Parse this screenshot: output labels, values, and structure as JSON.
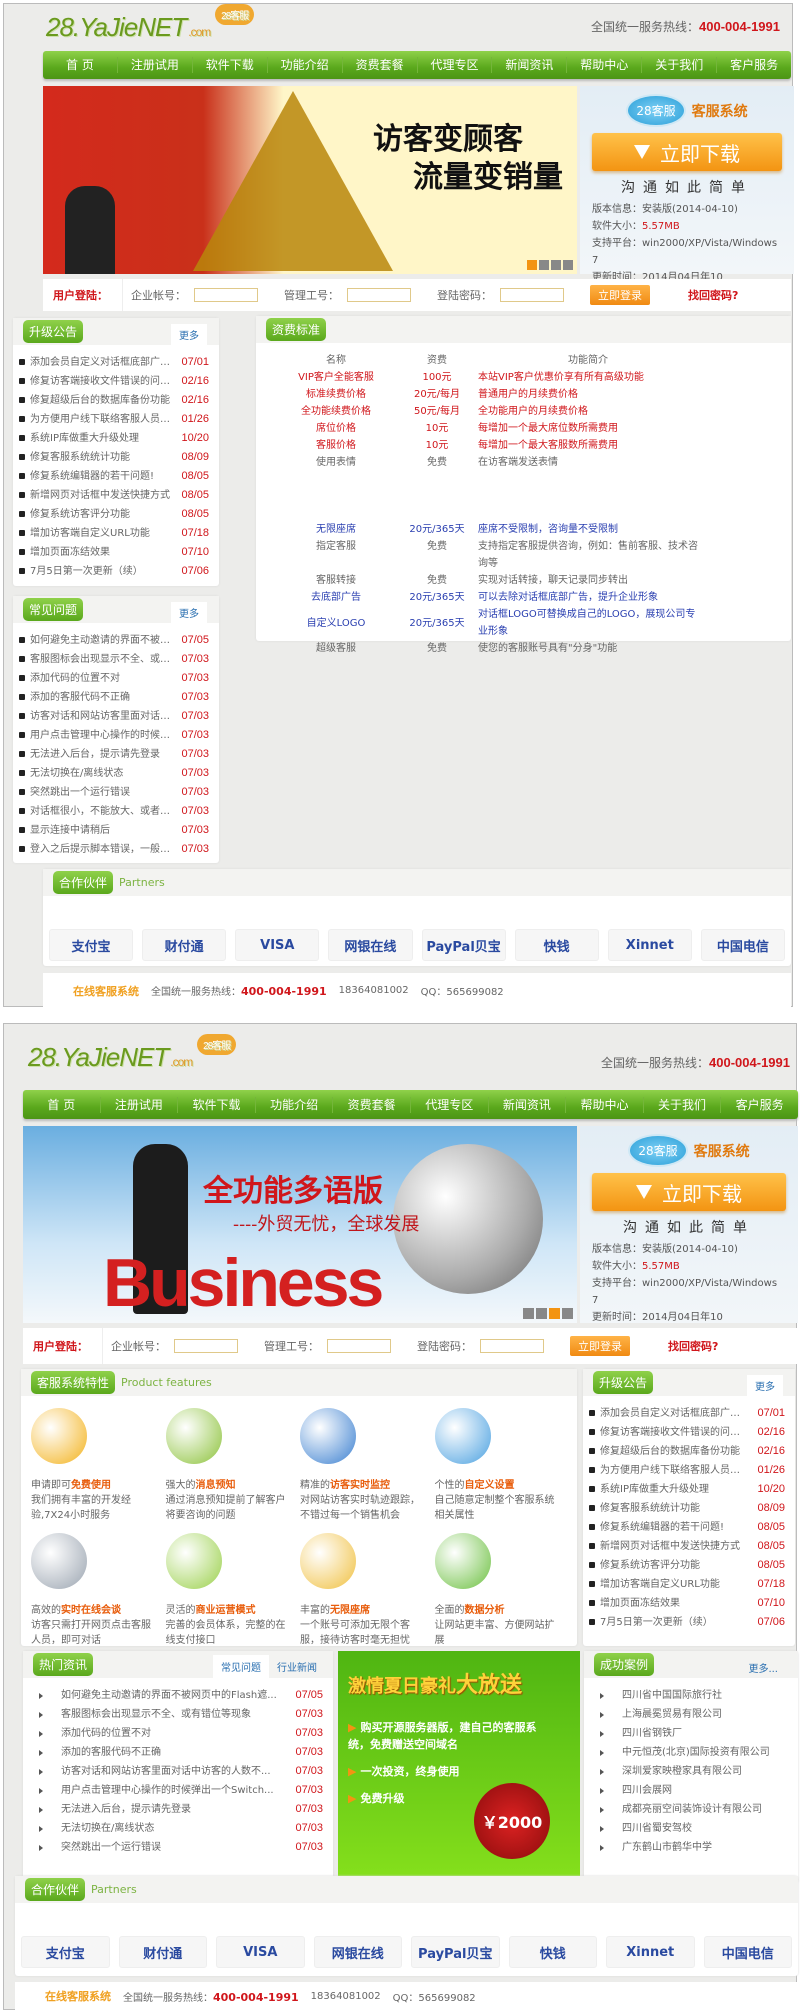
{
  "brand": {
    "logo": "28.YaJieNET",
    "logo_suffix": ".com",
    "logo_badge": "28客服"
  },
  "hotline_label": "全国统一服务热线：",
  "hotline": "400-004-1991",
  "nav": [
    "首 页",
    "注册试用",
    "软件下载",
    "功能介绍",
    "资费套餐",
    "代理专区",
    "新闻资讯",
    "帮助中心",
    "关于我们",
    "客户服务"
  ],
  "banners": {
    "first": {
      "line1": "访客变顾客",
      "line2": "流量变销量"
    },
    "second": {
      "line1": "全功能多语版",
      "line2": "----外贸无忧，全球发展",
      "word": "Business"
    }
  },
  "download": {
    "badge": "28客服",
    "title": "客服系统",
    "button": "立即下载",
    "slogan": "沟通如此简单",
    "rows": [
      {
        "label": "版本信息：",
        "value": "安装版(2014-04-10)"
      },
      {
        "label": "软件大小：",
        "value": "5.57MB"
      },
      {
        "label": "支持平台：",
        "value": "win2000/XP/Vista/Windows 7"
      },
      {
        "label": "更新时间：",
        "value": "2014月04日年10"
      }
    ]
  },
  "login": {
    "title": "用户登陆：",
    "company": "企业帐号：",
    "staff": "管理工号：",
    "password": "登陆密码：",
    "submit": "立即登录",
    "forgot": "找回密码?"
  },
  "upgrade": {
    "title": "升级公告",
    "more": "更多",
    "items": [
      {
        "t": "添加会员自定义对话框底部广告...",
        "d": "07/01"
      },
      {
        "t": "修复访客端接收文件错误的问题...",
        "d": "02/16"
      },
      {
        "t": "修复超级后台的数据库备份功能",
        "d": "02/16"
      },
      {
        "t": "为方便用户线下联络客服人员，...",
        "d": "01/26"
      },
      {
        "t": "系统IP库做重大升级处理",
        "d": "10/20"
      },
      {
        "t": "修复客服系统统计功能",
        "d": "08/09"
      },
      {
        "t": "修复系统编辑器的若干问题!",
        "d": "08/05"
      },
      {
        "t": "新增网页对话框中发送快捷方式",
        "d": "08/05"
      },
      {
        "t": "修复系统访客评分功能",
        "d": "08/05"
      },
      {
        "t": "增加访客端自定义URL功能",
        "d": "07/18"
      },
      {
        "t": "增加页面冻结效果",
        "d": "07/10"
      },
      {
        "t": "7月5日第一次更新（续）",
        "d": "07/06"
      }
    ]
  },
  "faq": {
    "title": "常见问题",
    "more": "更多",
    "items": [
      {
        "t": "如何避免主动邀请的界面不被网...",
        "d": "07/05"
      },
      {
        "t": "客服图标会出现显示不全、或有...",
        "d": "07/03"
      },
      {
        "t": "添加代码的位置不对",
        "d": "07/03"
      },
      {
        "t": "添加的客服代码不正确",
        "d": "07/03"
      },
      {
        "t": "访客对话和网站访客里面对话中...",
        "d": "07/03"
      },
      {
        "t": "用户点击管理中心操作的时候弹...",
        "d": "07/03"
      },
      {
        "t": "无法进入后台，提示请先登录",
        "d": "07/03"
      },
      {
        "t": "无法切换在/离线状态",
        "d": "07/03"
      },
      {
        "t": "突然跳出一个运行错误",
        "d": "07/03"
      },
      {
        "t": "对话框很小，不能放大、或者显...",
        "d": "07/03"
      },
      {
        "t": "显示连接中请稍后",
        "d": "07/03"
      },
      {
        "t": "登入之后提示脚本错误，一般是...",
        "d": "07/03"
      }
    ]
  },
  "pricing": {
    "title": "资费标准",
    "headers": [
      "名称",
      "资费",
      "功能简介"
    ],
    "rows": [
      {
        "name": "VIP客户全能客服",
        "price": "100元",
        "desc": "本站VIP客户优惠价享有所有高级功能",
        "color": "red"
      },
      {
        "name": "标准续费价格",
        "price": "20元/每月",
        "desc": "普通用户的月续费价格",
        "color": "red"
      },
      {
        "name": "全功能续费价格",
        "price": "50元/每月",
        "desc": "全功能用户的月续费价格",
        "color": "red"
      },
      {
        "name": "席位价格",
        "price": "10元",
        "desc": "每增加一个最大席位数所需费用",
        "color": "red"
      },
      {
        "name": "客服价格",
        "price": "10元",
        "desc": "每增加一个最大客服数所需费用",
        "color": "red"
      },
      {
        "name": "使用表情",
        "price": "免费",
        "desc": "在访客端发送表情",
        "color": "gray"
      },
      {
        "name": "无限座席",
        "price": "20元/365天",
        "desc": "座席不受限制，咨询量不受限制",
        "color": "blue"
      },
      {
        "name": "指定客服",
        "price": "免费",
        "desc": "支持指定客服提供咨询，例如：售前客服、技术咨询等",
        "color": "gray"
      },
      {
        "name": "客服转接",
        "price": "免费",
        "desc": "实现对话转接，聊天记录同步转出",
        "color": "gray"
      },
      {
        "name": "去底部广告",
        "price": "20元/365天",
        "desc": "可以去除对话框底部广告，提升企业形象",
        "color": "blue"
      },
      {
        "name": "自定义LOGO",
        "price": "20元/365天",
        "desc": "对话框LOGO可替换成自己的LOGO，展现公司专业形象",
        "color": "blue"
      },
      {
        "name": "超级客服",
        "price": "免费",
        "desc": "使您的客服账号具有\"分身\"功能",
        "color": "gray"
      }
    ]
  },
  "partners": {
    "title": "合作伙伴",
    "subtitle": "Partners",
    "logos": [
      "支付宝",
      "财付通",
      "VISA",
      "网银在线",
      "PayPal贝宝",
      "快钱",
      "Xinnet",
      "中国电信"
    ]
  },
  "footer": {
    "brand": "在线客服系统",
    "hotline_label": "全国统一服务热线：",
    "hotline": "400-004-1991",
    "phone": "18364081002",
    "qq": "QQ：565699082"
  },
  "features": {
    "title": "客服系统特性",
    "subtitle": "Product features",
    "items": [
      {
        "pre": "申请即可",
        "hl": "免费使用",
        "desc": "我们拥有丰富的开发经验,7X24小时服务",
        "color": "#f3b21c"
      },
      {
        "pre": "强大的",
        "hl": "消息预知",
        "desc": "通过消息预知提前了解客户将要咨询的问题",
        "color": "#8cc23a"
      },
      {
        "pre": "精准的",
        "hl": "访客实时监控",
        "desc": "对网站访客实时轨迹跟踪，不错过每一个销售机会",
        "color": "#3a7fd0"
      },
      {
        "pre": "个性的",
        "hl": "自定义设置",
        "desc": "自己随意定制整个客服系统相关属性",
        "color": "#4aa0e0"
      },
      {
        "pre": "高效的",
        "hl": "实时在线会谈",
        "desc": "访客只需打开网页点击客服人员，即可对话",
        "color": "#9aa4b0"
      },
      {
        "pre": "灵活的",
        "hl": "商业运营模式",
        "desc": "完善的会员体系，完整的在线支付接口",
        "color": "#9ad04a"
      },
      {
        "pre": "丰富的",
        "hl": "无限座席",
        "desc": "一个账号可添加无限个客服，接待访客时毫无担忧",
        "color": "#f0c040"
      },
      {
        "pre": "全面的",
        "hl": "数据分析",
        "desc": "让网站更丰富、方便网站扩展",
        "color": "#6cc040"
      }
    ]
  },
  "hot_news": {
    "title": "热门资讯",
    "tabs": [
      "常见问题",
      "行业新闻"
    ],
    "items": [
      {
        "t": "如何避免主动邀请的界面不被网页中的Flash遮...",
        "d": "07/05"
      },
      {
        "t": "客服图标会出现显示不全、或有错位等现象",
        "d": "07/03"
      },
      {
        "t": "添加代码的位置不对",
        "d": "07/03"
      },
      {
        "t": "添加的客服代码不正确",
        "d": "07/03"
      },
      {
        "t": "访客对话和网站访客里面对话中访客的人数不...",
        "d": "07/03"
      },
      {
        "t": "用户点击管理中心操作的时候弹出一个Switch...",
        "d": "07/03"
      },
      {
        "t": "无法进入后台，提示请先登录",
        "d": "07/03"
      },
      {
        "t": "无法切换在/离线状态",
        "d": "07/03"
      },
      {
        "t": "突然跳出一个运行错误",
        "d": "07/03"
      }
    ]
  },
  "promo": {
    "title_a": "激情夏日豪礼",
    "title_b": "大放送",
    "lines": [
      "购买开源服务器版，建自己的客服系统，免费赠送空间域名",
      "一次投资，终身使用",
      "免费升级"
    ],
    "price": "￥2000"
  },
  "cases": {
    "title": "成功案例",
    "more": "更多...",
    "items": [
      "四川省中国国际旅行社",
      "上海晨冕贸易有限公司",
      "四川省钢铁厂",
      "中元恒茂(北京)国际投资有限公司",
      "深圳爱家映橙家具有限公司",
      "四川会展网",
      "成都亮丽空间装饰设计有限公司",
      "四川省蜀安驾校",
      "广东鹤山市鹤华中学"
    ]
  }
}
